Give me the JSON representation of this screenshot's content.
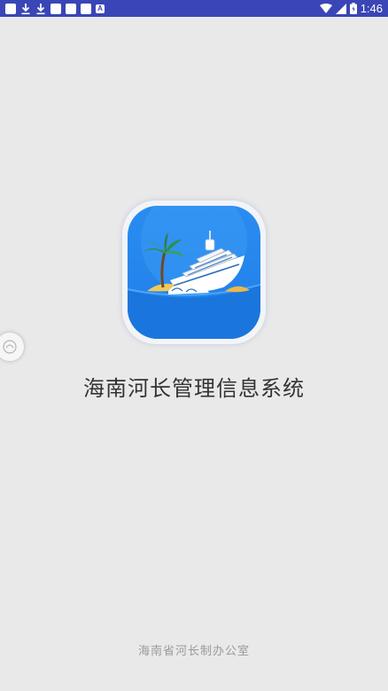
{
  "status_bar": {
    "time": "1:46",
    "left_icons": [
      "notification-square-icon",
      "download-icon",
      "download-icon",
      "notification-square-icon",
      "notification-square-icon",
      "notification-square-icon",
      "a-icon"
    ],
    "a_icon_text": "A",
    "right_icons": [
      "wifi-icon",
      "signal-icon",
      "battery-icon"
    ]
  },
  "app": {
    "title": "海南河长管理信息系统",
    "footer": "海南省河长制办公室"
  },
  "colors": {
    "status_bar": "#3a45b6",
    "background": "#e9e9ea",
    "icon_blue": "#1f7fe8"
  }
}
